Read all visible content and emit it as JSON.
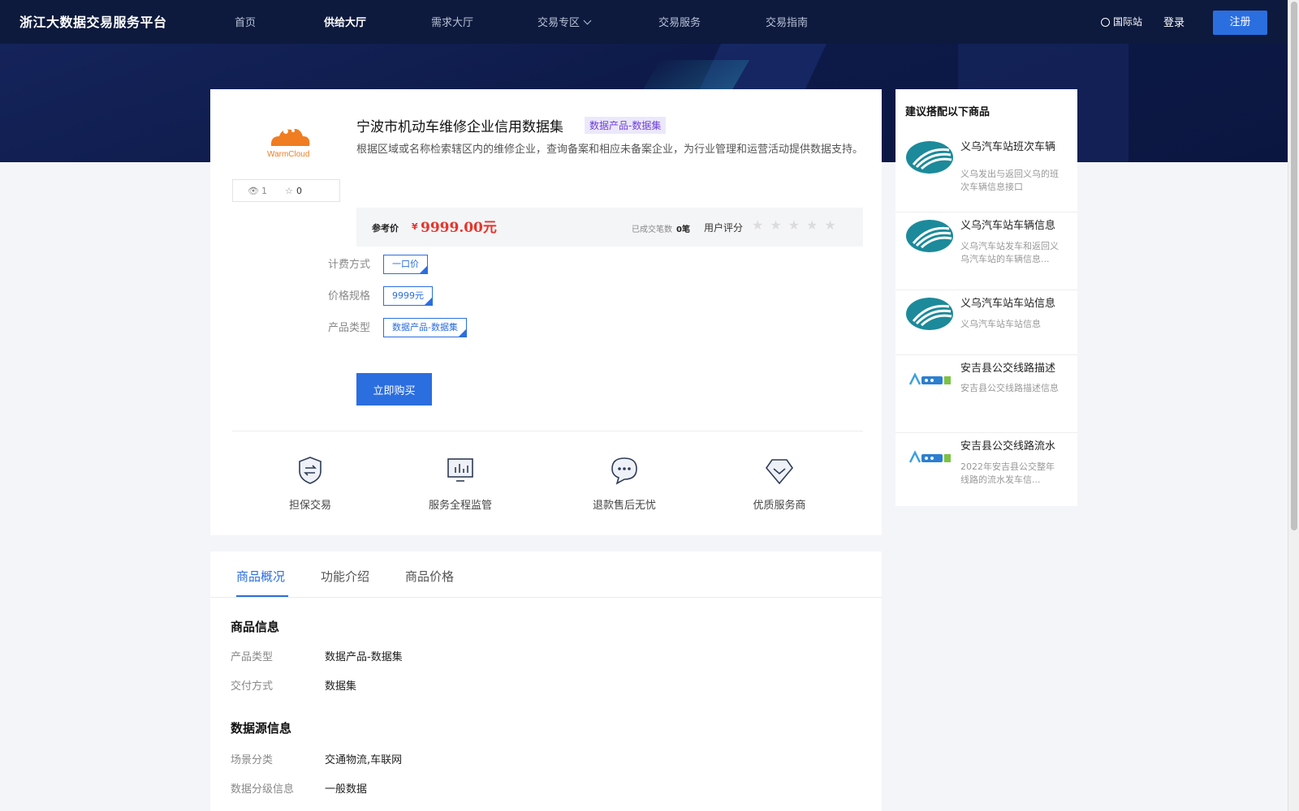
{
  "header": {
    "brand": "浙江大数据交易服务平台",
    "nav": [
      {
        "label": "首页"
      },
      {
        "label": "供给大厅"
      },
      {
        "label": "需求大厅"
      },
      {
        "label": "交易专区"
      },
      {
        "label": "交易服务"
      },
      {
        "label": "交易指南"
      }
    ],
    "intl": "国际站",
    "login": "登录",
    "register": "注册"
  },
  "product": {
    "logo_text": "WarmCloud",
    "views": "1",
    "favorites": "0",
    "title": "宁波市机动车维修企业信用数据集",
    "tag": "数据产品-数据集",
    "description": "根据区域或名称检索辖区内的维修企业，查询备案和相应未备案企业，为行业管理和运营活动提供数据支持。",
    "price_label": "参考价",
    "currency": "¥",
    "price": "9999.00元",
    "deals_label": "已成交笔数",
    "deals_value": "0笔",
    "rating_label": "用户评分",
    "rating": 0,
    "rating_max": 5,
    "specs": [
      {
        "label": "计费方式",
        "value": "一口价"
      },
      {
        "label": "价格规格",
        "value": "9999元"
      },
      {
        "label": "产品类型",
        "value": "数据产品-数据集"
      }
    ],
    "buy": "立即购买",
    "features": [
      {
        "label": "担保交易",
        "icon": "shield-exchange-icon"
      },
      {
        "label": "服务全程监管",
        "icon": "monitor-chart-icon"
      },
      {
        "label": "退款售后无忧",
        "icon": "chat-bubble-icon"
      },
      {
        "label": "优质服务商",
        "icon": "diamond-icon"
      }
    ]
  },
  "tabs": [
    {
      "label": "商品概况"
    },
    {
      "label": "功能介绍"
    },
    {
      "label": "商品价格"
    }
  ],
  "detail": {
    "goods_info_title": "商品信息",
    "goods_info": [
      {
        "label": "产品类型",
        "value": "数据产品-数据集"
      },
      {
        "label": "交付方式",
        "value": "数据集"
      }
    ],
    "source_title": "数据源信息",
    "source_info": [
      {
        "label": "场景分类",
        "value": "交通物流,车联网"
      },
      {
        "label": "数据分级信息",
        "value": "一般数据"
      }
    ]
  },
  "recommend": {
    "title": "建议搭配以下商品",
    "items": [
      {
        "name": "义乌汽车站班次车辆",
        "desc": "义乌发出与返回义乌的班次车辆信息接口",
        "logo": "yiwu-station-logo"
      },
      {
        "name": "义乌汽车站车辆信息",
        "desc": "义乌汽车站发车和返回义乌汽车站的车辆信息...",
        "logo": "yiwu-station-logo"
      },
      {
        "name": "义乌汽车站车站信息",
        "desc": "义乌汽车站车站信息",
        "logo": "yiwu-station-logo"
      },
      {
        "name": "安吉县公交线路描述",
        "desc": "安吉县公交线路描述信息",
        "logo": "adi-logo"
      },
      {
        "name": "安吉县公交线路流水",
        "desc": "2022年安吉县公交整年线路的流水发车信...",
        "logo": "adi-logo"
      }
    ]
  },
  "colors": {
    "accent": "#2b6ee0",
    "header_bg": "#0d1a3d",
    "price": "#e8332b",
    "tag_text": "#6c3fd6"
  }
}
